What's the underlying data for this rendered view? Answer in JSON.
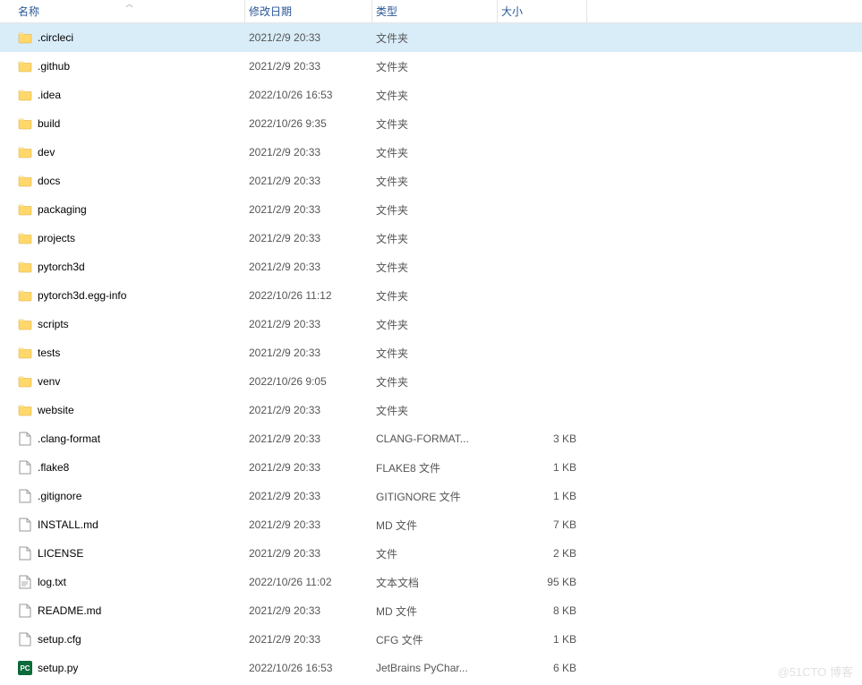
{
  "columns": {
    "name": "名称",
    "date": "修改日期",
    "type": "类型",
    "size": "大小"
  },
  "watermark": "@51CTO 博客",
  "items": [
    {
      "name": ".circleci",
      "date": "2021/2/9 20:33",
      "type": "文件夹",
      "size": "",
      "icon": "folder",
      "selected": true
    },
    {
      "name": ".github",
      "date": "2021/2/9 20:33",
      "type": "文件夹",
      "size": "",
      "icon": "folder"
    },
    {
      "name": ".idea",
      "date": "2022/10/26 16:53",
      "type": "文件夹",
      "size": "",
      "icon": "folder"
    },
    {
      "name": "build",
      "date": "2022/10/26 9:35",
      "type": "文件夹",
      "size": "",
      "icon": "folder"
    },
    {
      "name": "dev",
      "date": "2021/2/9 20:33",
      "type": "文件夹",
      "size": "",
      "icon": "folder"
    },
    {
      "name": "docs",
      "date": "2021/2/9 20:33",
      "type": "文件夹",
      "size": "",
      "icon": "folder"
    },
    {
      "name": "packaging",
      "date": "2021/2/9 20:33",
      "type": "文件夹",
      "size": "",
      "icon": "folder"
    },
    {
      "name": "projects",
      "date": "2021/2/9 20:33",
      "type": "文件夹",
      "size": "",
      "icon": "folder"
    },
    {
      "name": "pytorch3d",
      "date": "2021/2/9 20:33",
      "type": "文件夹",
      "size": "",
      "icon": "folder"
    },
    {
      "name": "pytorch3d.egg-info",
      "date": "2022/10/26 11:12",
      "type": "文件夹",
      "size": "",
      "icon": "folder"
    },
    {
      "name": "scripts",
      "date": "2021/2/9 20:33",
      "type": "文件夹",
      "size": "",
      "icon": "folder"
    },
    {
      "name": "tests",
      "date": "2021/2/9 20:33",
      "type": "文件夹",
      "size": "",
      "icon": "folder"
    },
    {
      "name": "venv",
      "date": "2022/10/26 9:05",
      "type": "文件夹",
      "size": "",
      "icon": "folder"
    },
    {
      "name": "website",
      "date": "2021/2/9 20:33",
      "type": "文件夹",
      "size": "",
      "icon": "folder"
    },
    {
      "name": ".clang-format",
      "date": "2021/2/9 20:33",
      "type": "CLANG-FORMAT...",
      "size": "3 KB",
      "icon": "file"
    },
    {
      "name": ".flake8",
      "date": "2021/2/9 20:33",
      "type": "FLAKE8 文件",
      "size": "1 KB",
      "icon": "file"
    },
    {
      "name": ".gitignore",
      "date": "2021/2/9 20:33",
      "type": "GITIGNORE 文件",
      "size": "1 KB",
      "icon": "file"
    },
    {
      "name": "INSTALL.md",
      "date": "2021/2/9 20:33",
      "type": "MD 文件",
      "size": "7 KB",
      "icon": "file"
    },
    {
      "name": "LICENSE",
      "date": "2021/2/9 20:33",
      "type": "文件",
      "size": "2 KB",
      "icon": "file"
    },
    {
      "name": "log.txt",
      "date": "2022/10/26 11:02",
      "type": "文本文档",
      "size": "95 KB",
      "icon": "text"
    },
    {
      "name": "README.md",
      "date": "2021/2/9 20:33",
      "type": "MD 文件",
      "size": "8 KB",
      "icon": "file"
    },
    {
      "name": "setup.cfg",
      "date": "2021/2/9 20:33",
      "type": "CFG 文件",
      "size": "1 KB",
      "icon": "file"
    },
    {
      "name": "setup.py",
      "date": "2022/10/26 16:53",
      "type": "JetBrains PyChar...",
      "size": "6 KB",
      "icon": "pc"
    }
  ]
}
